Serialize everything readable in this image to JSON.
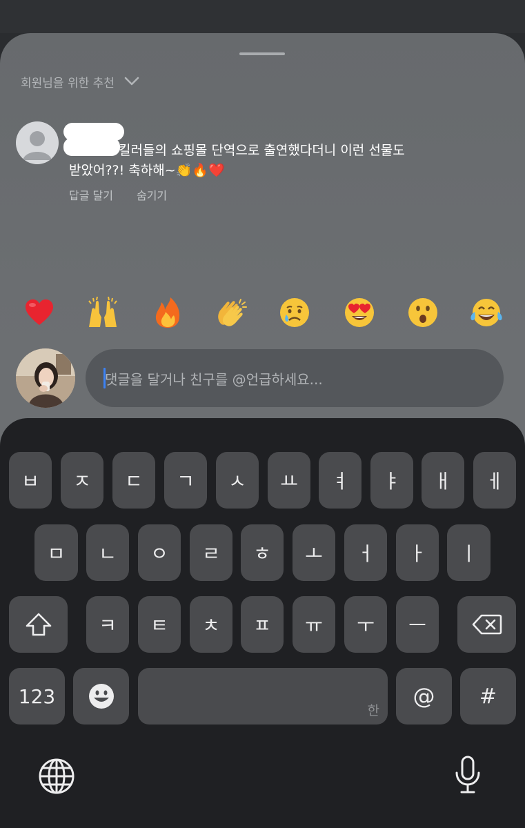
{
  "sheet": {
    "section_title": "회원님을 위한 추천"
  },
  "comment": {
    "text_line1": "킬러들의 쇼핑몰 단역으로 출연했다더니 이런 선물도",
    "text_line2": "받았어??! 축하해~👏🔥❤️",
    "reply_label": "답글 달기",
    "hide_label": "숨기기"
  },
  "reactions": [
    "❤️",
    "🙌",
    "🔥",
    "👏",
    "😢",
    "😍",
    "😮",
    "😂"
  ],
  "composer": {
    "placeholder": "댓글을 달거나 친구를 @언급하세요..."
  },
  "keyboard": {
    "row1": [
      "ㅂ",
      "ㅈ",
      "ㄷ",
      "ㄱ",
      "ㅅ",
      "ㅛ",
      "ㅕ",
      "ㅑ",
      "ㅐ",
      "ㅔ"
    ],
    "row2": [
      "ㅁ",
      "ㄴ",
      "ㅇ",
      "ㄹ",
      "ㅎ",
      "ㅗ",
      "ㅓ",
      "ㅏ",
      "ㅣ"
    ],
    "row3": [
      "ㅋ",
      "ㅌ",
      "ㅊ",
      "ㅍ",
      "ㅠ",
      "ㅜ",
      "ㅡ"
    ],
    "numbers_label": "123",
    "space_sub_label": "한",
    "at_label": "@",
    "hash_label": "#"
  },
  "icons": {
    "chevron": "chevron-down-icon",
    "shift": "shift-icon",
    "backspace": "backspace-icon",
    "emoji": "emoji-icon",
    "globe": "globe-icon",
    "mic": "microphone-icon"
  },
  "colors": {
    "sheet": "#6a6d70",
    "keyboard": "#1f2023",
    "key": "#4a4b4e",
    "caret": "#3b82f6"
  }
}
